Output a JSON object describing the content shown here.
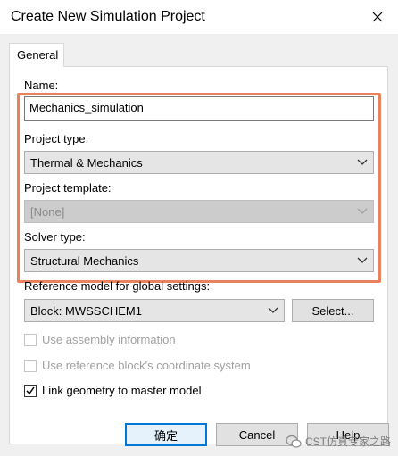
{
  "window": {
    "title": "Create New Simulation Project"
  },
  "tabs": [
    {
      "label": "General"
    }
  ],
  "form": {
    "name_label": "Name:",
    "name_value": "Mechanics_simulation",
    "project_type_label": "Project type:",
    "project_type_value": "Thermal & Mechanics",
    "project_template_label": "Project template:",
    "project_template_value": "[None]",
    "solver_type_label": "Solver type:",
    "solver_type_value": "Structural Mechanics",
    "reference_label": "Reference model for global settings:",
    "reference_value": "Block: MWSSCHEM1",
    "select_button": "Select...",
    "use_assembly_label": "Use assembly information",
    "use_reference_block_label": "Use reference block's coordinate system",
    "link_geometry_label": "Link geometry to master model",
    "link_geometry_checked": true
  },
  "buttons": {
    "ok": "确定",
    "cancel": "Cancel",
    "help": "Help"
  },
  "watermark": {
    "text": "CST仿真专家之路"
  },
  "colors": {
    "highlight": "#e8825c",
    "default_button_border": "#0078d7"
  }
}
